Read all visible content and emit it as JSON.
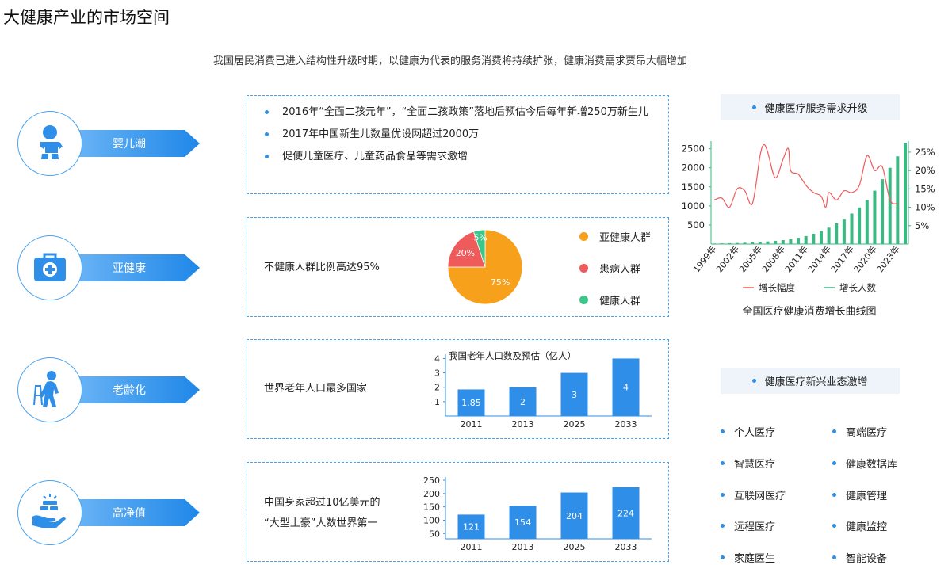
{
  "page": {
    "title": "大健康产业的市场空间",
    "subtitle": "我国居民消费已进入结构性升级时期，以健康为代表的服务消费将持续扩张，健康消费需求贾昂大幅增加"
  },
  "categories": [
    {
      "label": "婴儿潮",
      "icon": "baby-icon"
    },
    {
      "label": "亚健康",
      "icon": "medical-kit-icon"
    },
    {
      "label": "老龄化",
      "icon": "elderly-person-icon"
    },
    {
      "label": "高净值",
      "icon": "money-hand-icon"
    }
  ],
  "baby_boom": {
    "bullets": [
      "2016年“全面二孩元年”，“全面二孩政策”落地后预估今后每年新增250万新生儿",
      "2017年中国新生儿数量优设网超过2000万",
      "促使儿童医疗、儿童药品食品等需求激增"
    ]
  },
  "subhealth": {
    "text": "不健康人群比例高达95%",
    "legend": [
      "亚健康人群",
      "患病人群",
      "健康人群"
    ]
  },
  "aging": {
    "text": "世界老年人口最多国家"
  },
  "wealth": {
    "line1": "中国身家超过10亿美元的",
    "line2": "“大型土豪”人数世界第一"
  },
  "right": {
    "demand_header": "健康医疗服务需求升级",
    "chart_caption": "全国医疗健康消费增长曲线图",
    "industry_header": "健康医疗新兴业态激增",
    "industries": [
      "个人医疗",
      "高端医疗",
      "智慧医疗",
      "健康数据库",
      "互联网医疗",
      "健康管理",
      "远程医疗",
      "健康监控",
      "家庭医生",
      "智能设备"
    ]
  },
  "chart_data": [
    {
      "type": "pie",
      "labels": [
        "亚健康人群",
        "患病人群",
        "健康人群"
      ],
      "values": [
        75,
        20,
        5
      ],
      "value_labels": [
        "75%",
        "20%",
        "5%"
      ],
      "colors": [
        "#f7a01b",
        "#ef5a5a",
        "#3cc68a"
      ],
      "legend": "right"
    },
    {
      "type": "bar",
      "title": "我国老年人口数及预估（亿人）",
      "categories": [
        "2011",
        "2013",
        "2025",
        "2033"
      ],
      "values": [
        1.85,
        2,
        3,
        4
      ],
      "value_labels": [
        "1.85",
        "2",
        "3",
        "4"
      ],
      "yticks": [
        "1",
        "2",
        "3",
        "4"
      ],
      "ylim": [
        0,
        4.3
      ],
      "color": "#2f8fe8"
    },
    {
      "type": "bar",
      "title": "",
      "categories": [
        "2011",
        "2013",
        "2025",
        "2033"
      ],
      "values": [
        121,
        154,
        204,
        224
      ],
      "value_labels": [
        "121",
        "154",
        "204",
        "224"
      ],
      "yticks": [
        "50",
        "100",
        "150",
        "200",
        "250"
      ],
      "ylim": [
        30,
        262
      ],
      "color": "#2f8fe8"
    },
    {
      "type": "line",
      "title": "全国医疗健康消费增长曲线图",
      "x_labels": [
        "1999年",
        "2002年",
        "2005年",
        "2008年",
        "2011年",
        "2014年",
        "2017年",
        "2020年",
        "2023年"
      ],
      "x_start": 1999,
      "x_end": 2024,
      "y_left_ticks": [
        "500",
        "1000",
        "1500",
        "2000",
        "2500"
      ],
      "y_right_ticks": [
        "5%",
        "10%",
        "15%",
        "20%",
        "25%"
      ],
      "ylim_left": [
        0,
        2700
      ],
      "ylim_right": [
        0,
        28
      ],
      "legend": "bottom",
      "series": [
        {
          "name": "增长幅度",
          "axis": "right",
          "color": "#ef5a5a",
          "x": [
            1999,
            2000,
            2001,
            2002,
            2003,
            2004,
            2005,
            2005.5,
            2006,
            2007,
            2008,
            2008.7,
            2009,
            2010,
            2011,
            2012,
            2013,
            2013.6,
            2014,
            2015,
            2016,
            2017,
            2018,
            2019,
            2020,
            2021,
            2022,
            2023
          ],
          "values": [
            12,
            12.5,
            10,
            15,
            14.5,
            11,
            24,
            27,
            25,
            18,
            23,
            26,
            20,
            19,
            16,
            14,
            13,
            10,
            14,
            12,
            14.5,
            14,
            16,
            24,
            20,
            21,
            12,
            11
          ]
        },
        {
          "name": "增长人数",
          "axis": "left",
          "color": "#3cb883",
          "x": [
            1999,
            2000,
            2001,
            2002,
            2003,
            2004,
            2005,
            2006,
            2007,
            2008,
            2009,
            2010,
            2011,
            2012,
            2013,
            2014,
            2015,
            2016,
            2017,
            2018,
            2019,
            2020,
            2021,
            2022,
            2023,
            2024
          ],
          "values": [
            15,
            18,
            22,
            28,
            35,
            45,
            55,
            68,
            85,
            105,
            130,
            165,
            210,
            270,
            340,
            430,
            540,
            660,
            800,
            960,
            1150,
            1400,
            1700,
            2000,
            2300,
            2650
          ]
        }
      ]
    }
  ]
}
